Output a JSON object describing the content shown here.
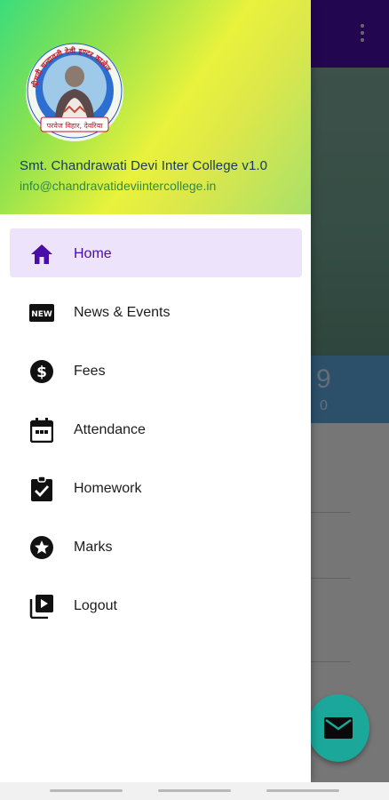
{
  "background": {
    "stat_value": "9",
    "stat_label": "0"
  },
  "drawer": {
    "app_title": "Smt. Chandrawati Devi Inter College v1.0",
    "email": "info@chandravatideviintercollege.in",
    "logo_text_top": "श्रीमती चन्द्रावती देवी इण्टर कालेज",
    "logo_text_bottom": "परवेज विहार, देवरिया",
    "menu": [
      {
        "label": "Home",
        "icon": "home-icon",
        "active": true
      },
      {
        "label": "News & Events",
        "icon": "new-badge-icon",
        "active": false
      },
      {
        "label": "Fees",
        "icon": "dollar-circle-icon",
        "active": false
      },
      {
        "label": "Attendance",
        "icon": "calendar-icon",
        "active": false
      },
      {
        "label": "Homework",
        "icon": "assignment-check-icon",
        "active": false
      },
      {
        "label": "Marks",
        "icon": "star-circle-icon",
        "active": false
      },
      {
        "label": "Logout",
        "icon": "video-library-icon",
        "active": false
      }
    ]
  },
  "colors": {
    "primary": "#4a0ea8",
    "active_bg": "#ede4fb",
    "fab": "#1ba89a"
  }
}
